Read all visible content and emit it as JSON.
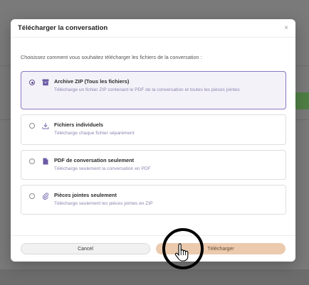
{
  "modal": {
    "title": "Télécharger la conversation",
    "close_symbol": "×",
    "instruction": "Choisissez comment vous souhaitez télécharger les fichiers de la conversation :"
  },
  "options": [
    {
      "title": "Archive ZIP (Tous les fichiers)",
      "description": "Télécharge un fichier ZIP contenant le PDF de la conversation et toutes les pièces jointes",
      "icon": "archive-icon",
      "selected": true
    },
    {
      "title": "Fichiers individuels",
      "description": "Télécharge chaque fichier séparément",
      "icon": "download-icon",
      "selected": false
    },
    {
      "title": "PDF de conversation seulement",
      "description": "Télécharge seulement la conversation en PDF",
      "icon": "document-icon",
      "selected": false
    },
    {
      "title": "Pièces jointes seulement",
      "description": "Télécharge seulement les pièces jointes en ZIP",
      "icon": "paperclip-icon",
      "selected": false
    }
  ],
  "footer": {
    "cancel_label": "Cancel",
    "download_label": "Télécharger"
  },
  "colors": {
    "accent": "#5b4a8f",
    "selected_bg": "#f4f2f9",
    "download_button": "#ebcaae",
    "overlay": "#7a7a7a"
  }
}
